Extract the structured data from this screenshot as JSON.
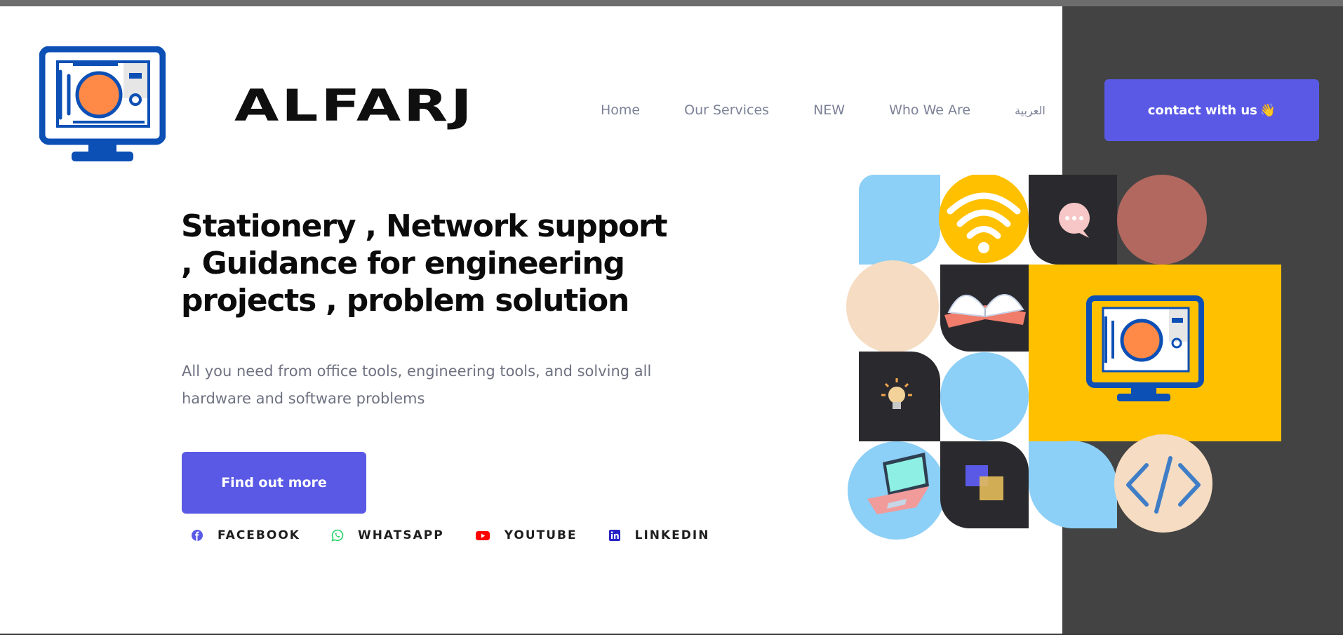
{
  "brand": {
    "name": "ALFARJ"
  },
  "nav": {
    "items": [
      {
        "label": "Home"
      },
      {
        "label": "Our Services"
      },
      {
        "label": "NEW"
      },
      {
        "label": "Who We Are"
      },
      {
        "label": "العربية"
      }
    ]
  },
  "header": {
    "contact_label": "contact with us",
    "contact_emoji": "👋"
  },
  "hero": {
    "title": "Stationery , Network support , Guidance for engineering projects , problem solution",
    "subtitle": "All you need from office tools, engineering tools, and solving all hardware and software problems",
    "cta_label": "Find out more"
  },
  "social": [
    {
      "label": "FACEBOOK",
      "icon": "facebook-icon",
      "color": "#5a59e6"
    },
    {
      "label": "WHATSAPP",
      "icon": "whatsapp-icon",
      "color": "#25d366"
    },
    {
      "label": "YOUTUBE",
      "icon": "youtube-icon",
      "color": "#ff0000"
    },
    {
      "label": "LINKEDIN",
      "icon": "linkedin-icon",
      "color": "#2723c7"
    }
  ],
  "colors": {
    "accent": "#5a59e6",
    "dark_panel": "#434343",
    "logo_blue": "#0c4fb5",
    "logo_orange": "#ff8a47",
    "mosaic_yellow": "#ffc000",
    "mosaic_light_blue": "#8ccff7"
  }
}
